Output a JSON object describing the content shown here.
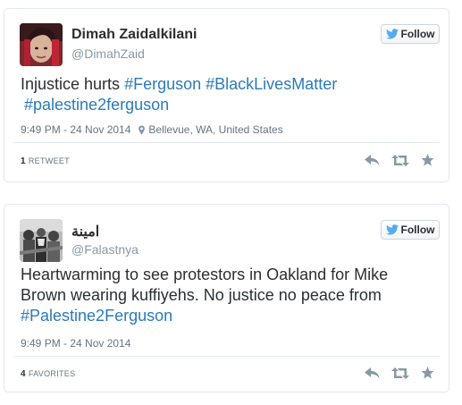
{
  "tweets": [
    {
      "name": "Dimah Zaidalkilani",
      "handle": "@DimahZaid",
      "follow_label": "Follow",
      "text_parts": [
        "Injustice hurts ",
        "#Ferguson",
        " ",
        "#BlackLivesMatter",
        " ",
        "#palestine2ferguson"
      ],
      "timestamp": "9:49 PM - 24 Nov 2014",
      "location": "Bellevue, WA, United States",
      "stat_count": "1",
      "stat_label": "RETWEET"
    },
    {
      "name": "امينة",
      "handle": "@Falastnya",
      "follow_label": "Follow",
      "text_parts": [
        "Heartwarming to see protestors in Oakland for Mike Brown wearing kuffiyehs. No justice no peace from ",
        "#Palestine2Ferguson"
      ],
      "timestamp": "9:49 PM - 24 Nov 2014",
      "stat_count": "4",
      "stat_label": "FAVORITES"
    }
  ],
  "colors": {
    "link": "#2b7bb9",
    "text": "#292f33",
    "muted": "#66757f",
    "handle": "#8899a6",
    "twitter_blue": "#55acee",
    "border": "#e1e8ed"
  },
  "icons": [
    "twitter-bird-icon",
    "location-pin-icon",
    "reply-icon",
    "retweet-icon",
    "favorite-star-icon"
  ]
}
